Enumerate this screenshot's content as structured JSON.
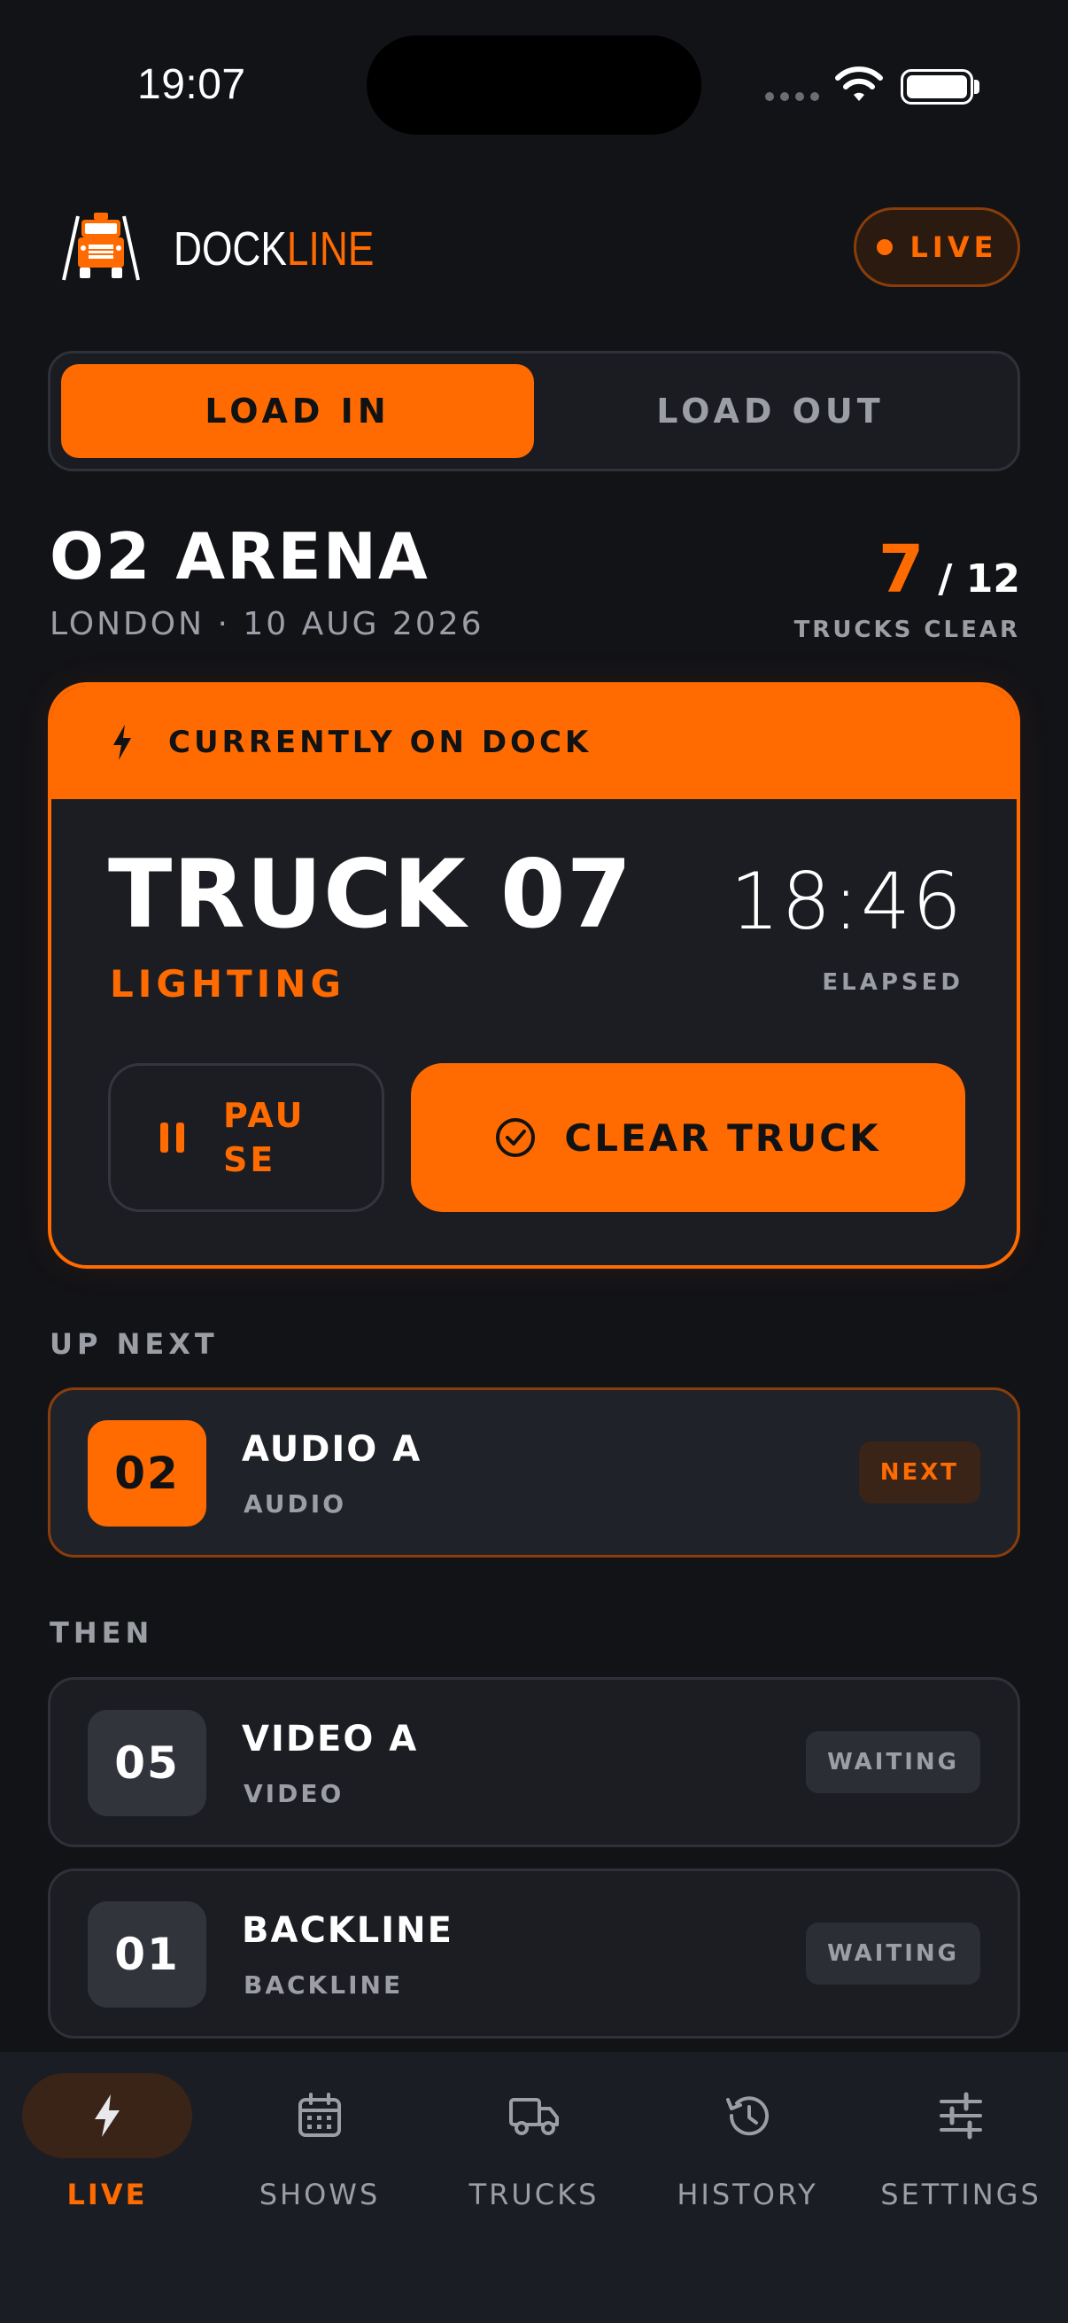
{
  "status_bar": {
    "time": "19:07"
  },
  "header": {
    "brand_part1": "DOCK",
    "brand_part2": "LINE",
    "live_label": "LIVE"
  },
  "segment": {
    "active": "LOAD IN",
    "inactive": "LOAD OUT"
  },
  "venue": {
    "title": "O2 ARENA",
    "subtitle": "LONDON · 10 AUG 2026",
    "trucks_cleared": "7",
    "trucks_total": "/ 12",
    "count_label": "TRUCKS CLEAR"
  },
  "dock": {
    "header_label": "CURRENTLY ON DOCK",
    "truck_name": "TRUCK 07",
    "department": "LIGHTING",
    "timer": "18:46",
    "timer_label": "ELAPSED",
    "pause_label": "PAUSE",
    "clear_label": "CLEAR TRUCK"
  },
  "up_next": {
    "label": "UP NEXT",
    "item": {
      "number": "02",
      "title": "AUDIO A",
      "department": "AUDIO",
      "badge": "NEXT"
    }
  },
  "then": {
    "label": "THEN",
    "items": [
      {
        "number": "05",
        "title": "VIDEO A",
        "department": "VIDEO",
        "badge": "WAITING"
      },
      {
        "number": "01",
        "title": "BACKLINE",
        "department": "BACKLINE",
        "badge": "WAITING"
      }
    ]
  },
  "tabs": [
    {
      "label": "LIVE",
      "icon": "bolt-icon",
      "active": true
    },
    {
      "label": "SHOWS",
      "icon": "calendar-icon",
      "active": false
    },
    {
      "label": "TRUCKS",
      "icon": "truck-icon",
      "active": false
    },
    {
      "label": "HISTORY",
      "icon": "history-icon",
      "active": false
    },
    {
      "label": "SETTINGS",
      "icon": "sliders-icon",
      "active": false
    }
  ],
  "colors": {
    "accent": "#ff6b00",
    "background": "#121317",
    "card": "#1b1d23",
    "muted": "#9c9ea5"
  }
}
